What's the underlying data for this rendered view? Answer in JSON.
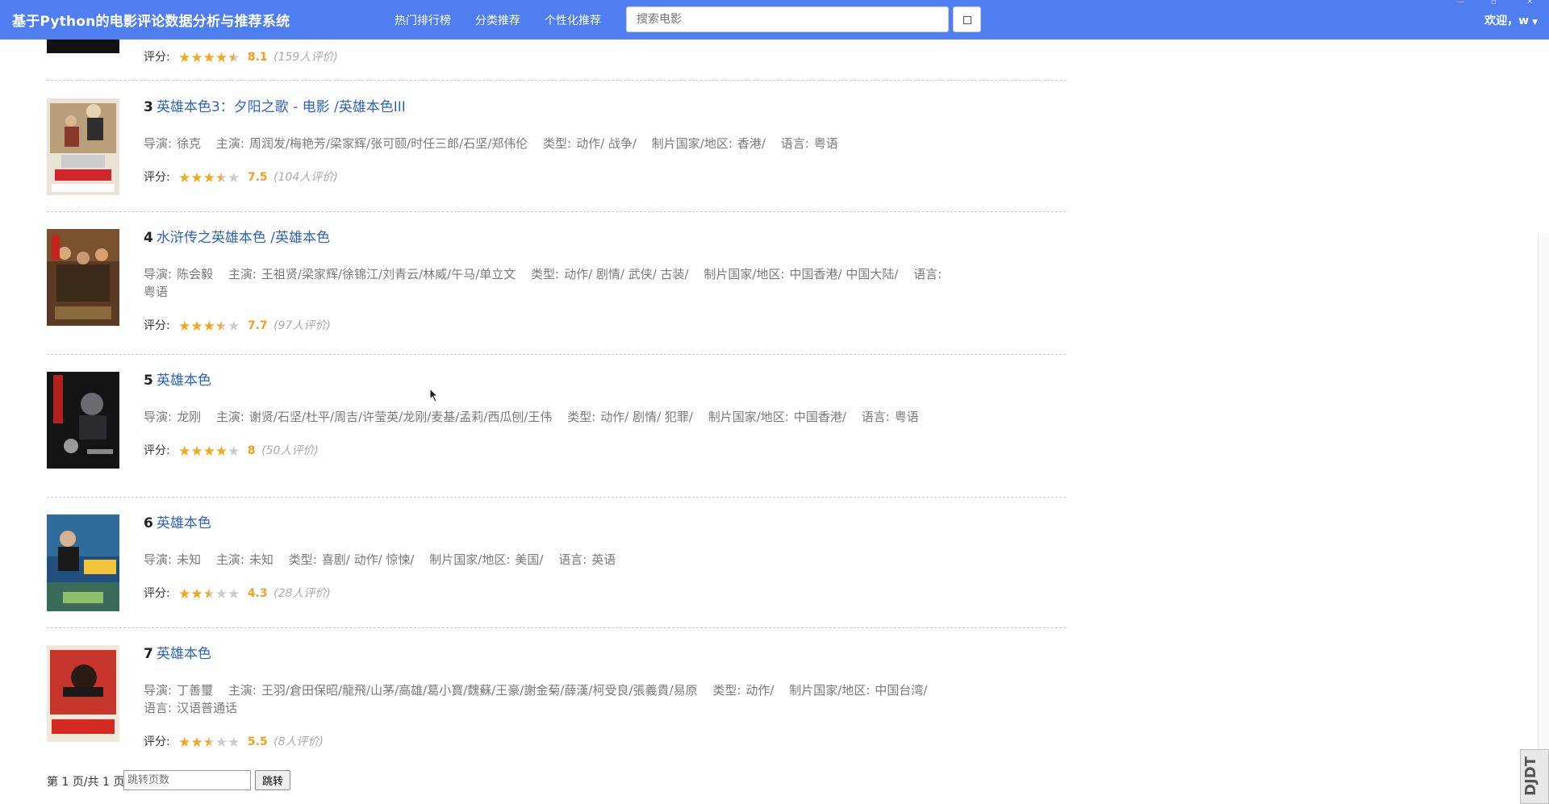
{
  "header": {
    "brand": "基于Python的电影评论数据分析与推荐系统",
    "nav": [
      "热门排行榜",
      "分类推荐",
      "个性化推荐"
    ],
    "search_placeholder": "搜索电影",
    "welcome": "欢迎，w"
  },
  "labels": {
    "director": "导演:",
    "actors": "主演:",
    "genre": "类型:",
    "country": "制片国家/地区:",
    "language": "语言:",
    "rating": "评分:"
  },
  "movies": [
    {
      "rank": "",
      "title": "",
      "director": "",
      "actors": "",
      "genre": "",
      "country": "",
      "language": "",
      "score": "8.1",
      "count": "(159人评价)",
      "stars": 4.5,
      "poster": "dark-icon"
    },
    {
      "rank": "3",
      "title": "英雄本色3：夕阳之歌 - 电影 /英雄本色III",
      "director": "徐克",
      "actors": "周润发/梅艳芳/梁家辉/张可颐/时任三郎/石坚/郑伟伦",
      "genre": "动作/ 战争/",
      "country": "香港/",
      "language": "粤语",
      "score": "7.5",
      "count": "(104人评价)",
      "stars": 3.5,
      "poster": "poster-3-icon"
    },
    {
      "rank": "4",
      "title": "水浒传之英雄本色 /英雄本色",
      "director": "陈会毅",
      "actors": "王祖贤/梁家辉/徐锦江/刘青云/林威/午马/单立文",
      "genre": "动作/ 剧情/ 武侠/ 古装/",
      "country": "中国香港/ 中国大陆/",
      "language": "粤语",
      "score": "7.7",
      "count": "(97人评价)",
      "stars": 3.5,
      "poster": "poster-4-icon"
    },
    {
      "rank": "5",
      "title": "英雄本色",
      "director": "龙刚",
      "actors": "谢贤/石坚/杜平/周吉/许莹英/龙刚/麦基/孟莉/西瓜刨/王伟",
      "genre": "动作/ 剧情/ 犯罪/",
      "country": "中国香港/",
      "language": "粤语",
      "score": "8",
      "count": "(50人评价)",
      "stars": 4,
      "poster": "poster-5-icon"
    },
    {
      "rank": "6",
      "title": "英雄本色",
      "director": "未知",
      "actors": "未知",
      "genre": "喜剧/ 动作/ 惊悚/",
      "country": "美国/",
      "language": "英语",
      "score": "4.3",
      "count": "(28人评价)",
      "stars": 2.5,
      "poster": "poster-6-icon"
    },
    {
      "rank": "7",
      "title": "英雄本色",
      "director": "丁善璽",
      "actors": "王羽/倉田保昭/龍飛/山茅/高雄/葛小寶/魏蘇/王豪/謝金菊/薛漢/柯受良/張義貴/易原",
      "genre": "动作/",
      "country": "中国台湾/",
      "language": "汉语普通话",
      "score": "5.5",
      "count": "(8人评价)",
      "stars": 2.5,
      "poster": "poster-7-icon"
    }
  ],
  "pagination": {
    "text": "第 1 页/共 1 页",
    "jump_placeholder": "跳转页数",
    "jump_label": "跳转"
  },
  "watermark": "DJDT",
  "colors": {
    "navbar": "#4f7ef0",
    "title_link": "#2d62c1",
    "star": "#f2a81b",
    "score": "#f0a020"
  }
}
